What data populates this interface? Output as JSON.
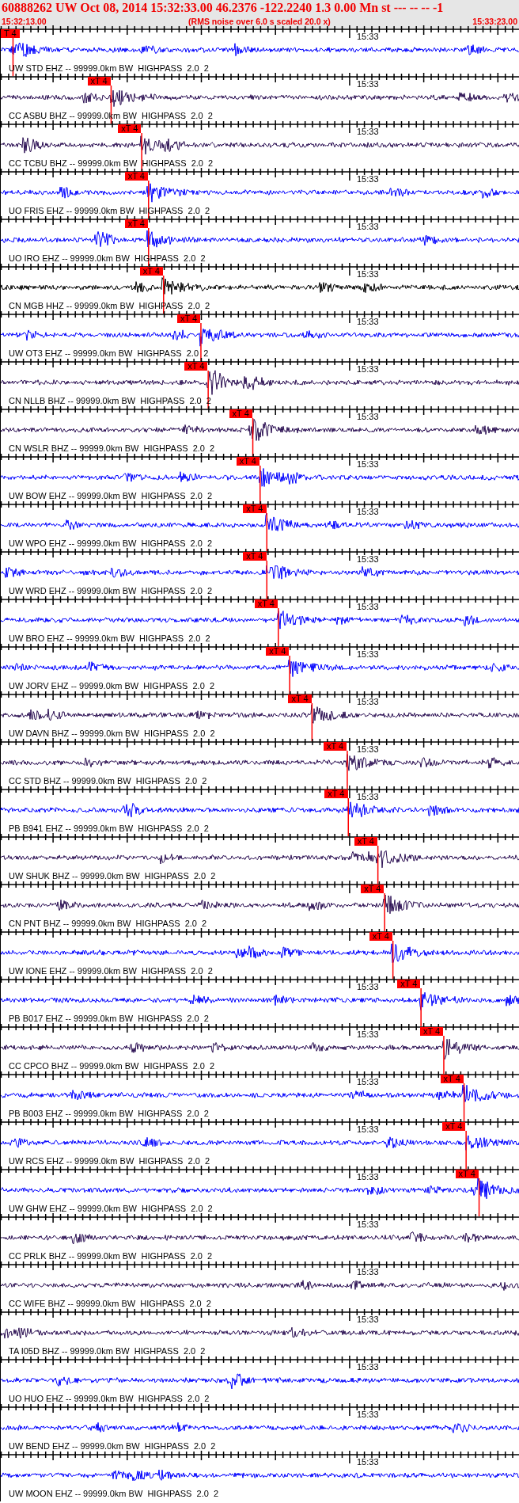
{
  "header": {
    "title": "60888262 UW Oct 08, 2014 15:32:33.00   46.2376 -122.2240  1.3 0.00 Mn st --- -- --  -1",
    "start_time": "15:32:13.00",
    "note": "(RMS noise over 6.0 s scaled 20.0 x)",
    "end_time": "15:33:23.00"
  },
  "tracks": [
    {
      "label": "UW STD EHZ -- 99999.0km BW  HIGHPASS  2.0  2",
      "time_label": "15:33",
      "color": "#0000ff",
      "pick": {
        "label": "T 4",
        "level": 0.024
      }
    },
    {
      "label": "CC ASBU BHZ -- 99999.0km BW  HIGHPASS  2.0  2",
      "time_label": "15:33",
      "color": "#2a0e52",
      "pick": {
        "label": "xT 4",
        "level": 0.213
      }
    },
    {
      "label": "CC TCBU BHZ -- 99999.0km BW  HIGHPASS  2.0  2",
      "time_label": "15:33",
      "color": "#2a0e52",
      "pick": {
        "label": "xT 4",
        "level": 0.272
      }
    },
    {
      "label": "UO FRIS EHZ -- 99999.0km BW  HIGHPASS  2.0  2",
      "time_label": "15:33",
      "color": "#0000ff",
      "pick": {
        "label": "xT 4",
        "level": 0.285
      }
    },
    {
      "label": "UO IRO EHZ -- 99999.0km BW  HIGHPASS  2.0  2",
      "time_label": "15:33",
      "color": "#0000ff",
      "pick": {
        "label": "xT 4",
        "level": 0.285
      }
    },
    {
      "label": "CN MGB HHZ -- 99999.0km BW  HIGHPASS  2.0  2",
      "time_label": "15:33",
      "color": "#000000",
      "pick": {
        "label": "xT 4",
        "level": 0.314
      }
    },
    {
      "label": "UW OT3 EHZ -- 99999.0km BW  HIGHPASS  2.0  2",
      "time_label": "15:33",
      "color": "#0000ff",
      "pick": {
        "label": "xT 4",
        "level": 0.386
      }
    },
    {
      "label": "CN NLLB BHZ -- 99999.0km BW  HIGHPASS  2.0  2",
      "time_label": "15:33",
      "color": "#2a0e52",
      "pick": {
        "label": "xT 4",
        "level": 0.4
      }
    },
    {
      "label": "CN WSLR BHZ -- 99999.0km BW  HIGHPASS  2.0  2",
      "time_label": "15:33",
      "color": "#2a0e52",
      "pick": {
        "label": "xT 4",
        "level": 0.486
      }
    },
    {
      "label": "UW BOW EHZ -- 99999.0km BW  HIGHPASS  2.0  2",
      "time_label": "15:33",
      "color": "#0000ff",
      "pick": {
        "label": "xT 4",
        "level": 0.5
      }
    },
    {
      "label": "UW WPO EHZ -- 99999.0km BW  HIGHPASS  2.0  2",
      "time_label": "15:33",
      "color": "#0000ff",
      "pick": {
        "label": "xT 4",
        "level": 0.513
      }
    },
    {
      "label": "UW WRD EHZ -- 99999.0km BW  HIGHPASS  2.0  2",
      "time_label": "15:33",
      "color": "#0000ff",
      "pick": {
        "label": "xT 4",
        "level": 0.513
      }
    },
    {
      "label": "UW BRO EHZ -- 99999.0km BW  HIGHPASS  2.0  2",
      "time_label": "15:33",
      "color": "#0000ff",
      "pick": {
        "label": "xT 4",
        "level": 0.535
      }
    },
    {
      "label": "UW JORV EHZ -- 99999.0km BW  HIGHPASS  2.0  2",
      "time_label": "15:33",
      "color": "#0000ff",
      "pick": {
        "label": "xT 4",
        "level": 0.557
      }
    },
    {
      "label": "UW DAVN BHZ -- 99999.0km BW  HIGHPASS  2.0  2",
      "time_label": "15:33",
      "color": "#2a0e52",
      "pick": {
        "label": "xT 4",
        "level": 0.6
      }
    },
    {
      "label": "CC STD BHZ -- 99999.0km BW  HIGHPASS  2.0  2",
      "time_label": "15:33",
      "color": "#2a0e52",
      "pick": {
        "label": "xT 4",
        "level": 0.668
      }
    },
    {
      "label": "PB B941 EHZ -- 99999.0km BW  HIGHPASS  2.0  2",
      "time_label": "15:33",
      "color": "#0000ff",
      "pick": {
        "label": "xT 4",
        "level": 0.67
      }
    },
    {
      "label": "UW SHUK BHZ -- 99999.0km BW  HIGHPASS  2.0  2",
      "color": "#2a0e52",
      "pick": {
        "label": "xT 4",
        "level": 0.727
      }
    },
    {
      "label": "CN PNT BHZ -- 99999.0km BW  HIGHPASS  2.0  2",
      "color": "#2a0e52",
      "pick": {
        "label": "xT 4",
        "level": 0.74
      }
    },
    {
      "label": "UW IONE EHZ -- 99999.0km BW  HIGHPASS  2.0  2",
      "color": "#0000ff",
      "pick": {
        "label": "xT 4",
        "level": 0.756
      }
    },
    {
      "label": "PB B017 EHZ -- 99999.0km BW  HIGHPASS  2.0  2",
      "time_label": "15:33",
      "color": "#0000ff",
      "pick": {
        "label": "xT 4",
        "level": 0.81
      }
    },
    {
      "label": "CC CPCO BHZ -- 99999.0km BW  HIGHPASS  2.0  2",
      "time_label": "15:33",
      "color": "#2a0e52",
      "pick": {
        "label": "xT 4",
        "level": 0.854
      }
    },
    {
      "label": "PB B003 EHZ -- 99999.0km BW  HIGHPASS  2.0  2",
      "time_label": "15:33",
      "color": "#0000ff",
      "pick": {
        "label": "xT 4",
        "level": 0.893
      }
    },
    {
      "label": "UW RCS EHZ -- 99999.0km BW  HIGHPASS  2.0  2",
      "time_label": "15:33",
      "color": "#0000ff",
      "pick": {
        "label": "xT 4",
        "level": 0.897
      }
    },
    {
      "label": "UW GHW EHZ -- 99999.0km BW  HIGHPASS  2.0  2",
      "time_label": "15:33",
      "color": "#0000ff",
      "pick": {
        "label": "xT 4",
        "level": 0.922
      }
    },
    {
      "label": "CC PRLK BHZ -- 99999.0km BW  HIGHPASS  2.0  2",
      "time_label": "15:33",
      "color": "#2a0e52"
    },
    {
      "label": "CC WIFE BHZ -- 99999.0km BW  HIGHPASS  2.0  2",
      "time_label": "15:33",
      "color": "#2a0e52"
    },
    {
      "label": "TA I05D BHZ -- 99999.0km BW  HIGHPASS  2.0  2",
      "time_label": "15:33",
      "color": "#2a0e52"
    },
    {
      "label": "UO HUO EHZ -- 99999.0km BW  HIGHPASS  2.0  2",
      "time_label": "15:33",
      "color": "#0000ff"
    },
    {
      "label": "UW BEND EHZ -- 99999.0km BW  HIGHPASS  2.0  2",
      "time_label": "15:33",
      "color": "#0000ff"
    },
    {
      "label": "UW MOON EHZ -- 99999.0km BW  HIGHPASS  2.0  2",
      "time_label": "15:33",
      "color": "#0000ff"
    }
  ]
}
